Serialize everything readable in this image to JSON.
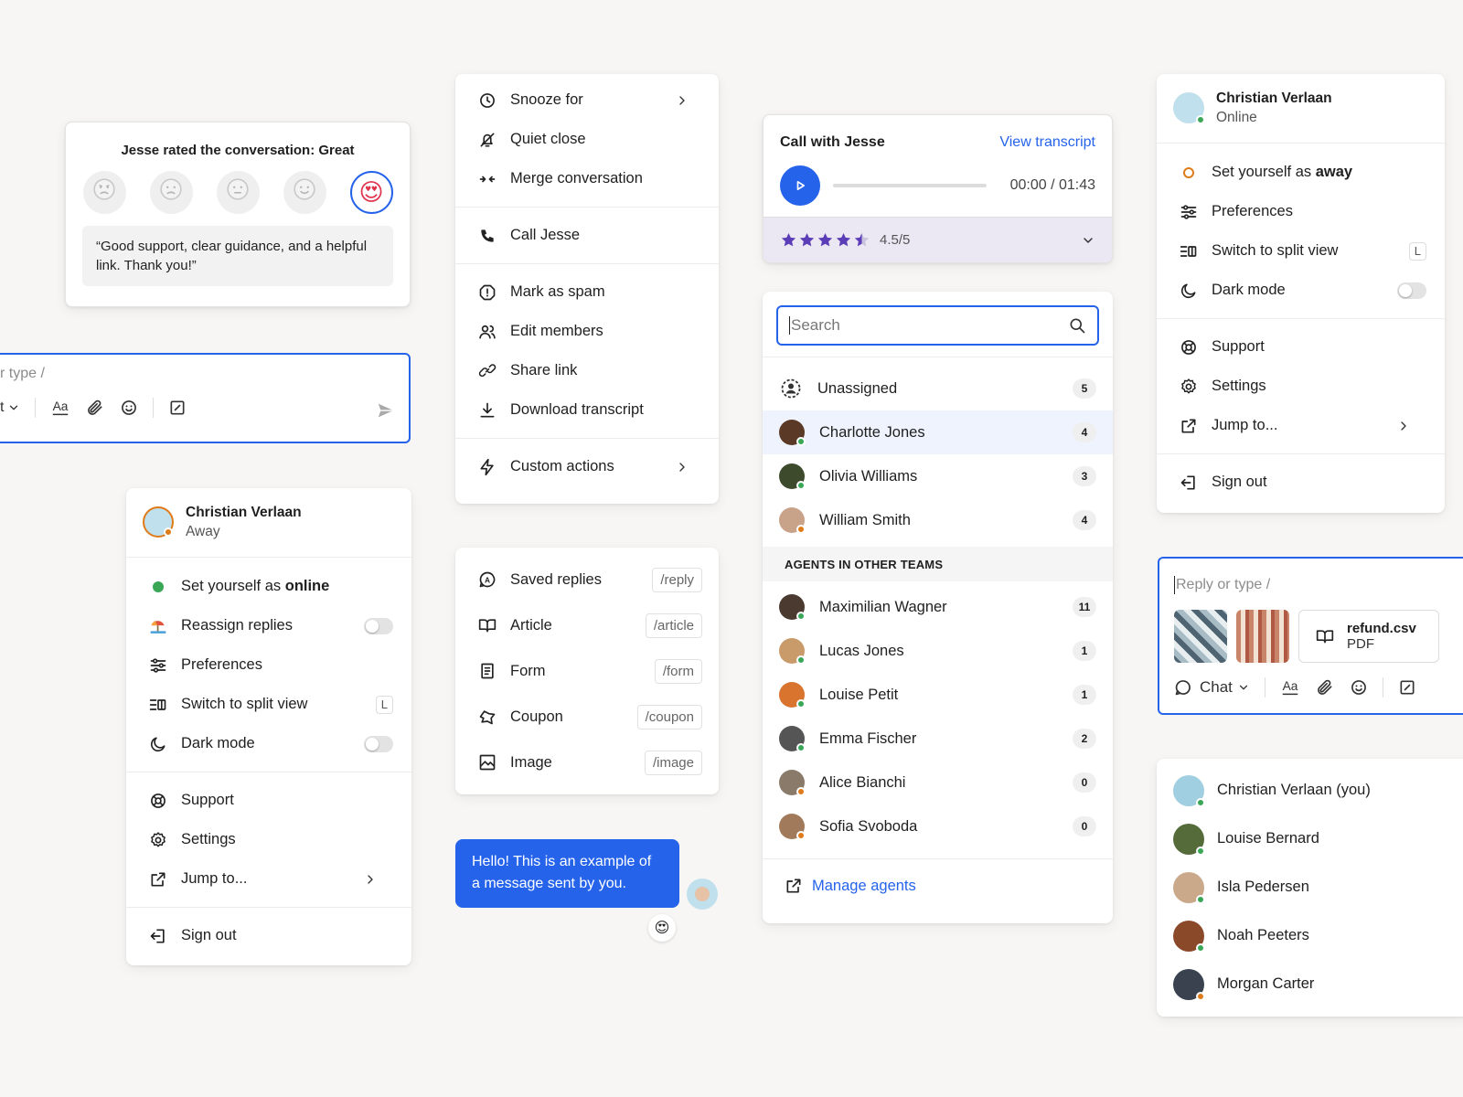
{
  "rating": {
    "title": "Jesse rated the conversation: Great",
    "faces": [
      "angry-face",
      "sad-face",
      "neutral-face",
      "smile-face",
      "heart-eyes-face"
    ],
    "selected": 4,
    "quote": "“Good support, clear guidance, and a helpful link. Thank you!”"
  },
  "composer_left": {
    "placeholder": "r type /",
    "mode_label": "t"
  },
  "menu": {
    "items": [
      {
        "label": "Snooze for",
        "icon": "clock-icon"
      },
      {
        "label": "Quiet close",
        "icon": "bell-off-icon"
      },
      {
        "label": "Merge conversation",
        "icon": "merge-icon"
      },
      {
        "label": "Call Jesse",
        "icon": "phone-icon"
      },
      {
        "label": "Mark as spam",
        "icon": "spam-icon"
      },
      {
        "label": "Edit members",
        "icon": "users-icon"
      },
      {
        "label": "Share link",
        "icon": "link-icon"
      },
      {
        "label": "Download transcript",
        "icon": "download-icon"
      },
      {
        "label": "Custom actions",
        "icon": "bolt-icon"
      }
    ]
  },
  "slash": {
    "items": [
      {
        "label": "Saved replies",
        "cmd": "/reply",
        "icon": "saved-reply-icon"
      },
      {
        "label": "Article",
        "cmd": "/article",
        "icon": "book-icon"
      },
      {
        "label": "Form",
        "cmd": "/form",
        "icon": "form-icon"
      },
      {
        "label": "Coupon",
        "cmd": "/coupon",
        "icon": "coupon-icon"
      },
      {
        "label": "Image",
        "cmd": "/image",
        "icon": "image-icon"
      }
    ]
  },
  "message": {
    "text": "Hello! This is an example of a message sent by you.",
    "reaction": "😍"
  },
  "call": {
    "title": "Call with Jesse",
    "view_transcript": "View transcript",
    "time": "00:00 / 01:43",
    "progress": 0,
    "stars": 4.5,
    "rating_text": "4.5/5"
  },
  "agents": {
    "search_placeholder": "Search",
    "unassigned": {
      "label": "Unassigned",
      "count": "5"
    },
    "team": [
      {
        "name": "Charlotte Jones",
        "count": "4",
        "status": "online",
        "color": "#5a3a26"
      },
      {
        "name": "Olivia Williams",
        "count": "3",
        "status": "online",
        "color": "#3d4a2c"
      },
      {
        "name": "William Smith",
        "count": "4",
        "status": "away",
        "color": "#c9a28a"
      }
    ],
    "section_title": "AGENTS IN OTHER TEAMS",
    "others": [
      {
        "name": "Maximilian Wagner",
        "count": "11",
        "status": "online",
        "color": "#4a3a30"
      },
      {
        "name": "Lucas Jones",
        "count": "1",
        "status": "online",
        "color": "#c99b6a"
      },
      {
        "name": "Louise Petit",
        "count": "1",
        "status": "online",
        "color": "#d9742e"
      },
      {
        "name": "Emma Fischer",
        "count": "2",
        "status": "online",
        "color": "#555555"
      },
      {
        "name": "Alice Bianchi",
        "count": "0",
        "status": "away",
        "color": "#8a7a6a"
      },
      {
        "name": "Sofia Svoboda",
        "count": "0",
        "status": "away",
        "color": "#a07a5a"
      }
    ],
    "manage": "Manage agents"
  },
  "profile_away": {
    "name": "Christian Verlaan",
    "status": "Away",
    "set_prefix": "Set yourself as ",
    "set_bold": "online",
    "items": [
      {
        "label": "Reassign replies",
        "icon": "beach-icon",
        "extra": "toggle"
      },
      {
        "label": "Preferences",
        "icon": "sliders-icon"
      },
      {
        "label": "Switch to split view",
        "icon": "split-view-icon",
        "extra": "L"
      },
      {
        "label": "Dark mode",
        "icon": "moon-icon",
        "extra": "toggle"
      }
    ],
    "items2": [
      {
        "label": "Support",
        "icon": "lifebuoy-icon"
      },
      {
        "label": "Settings",
        "icon": "gear-icon"
      },
      {
        "label": "Jump to...",
        "icon": "external-link-icon"
      }
    ],
    "sign_out": "Sign out"
  },
  "profile_online": {
    "name": "Christian Verlaan",
    "status": "Online",
    "set_prefix": "Set yourself as ",
    "set_bold": "away",
    "items": [
      {
        "label": "Preferences",
        "icon": "sliders-icon"
      },
      {
        "label": "Switch to split view",
        "icon": "split-view-icon",
        "extra": "L"
      },
      {
        "label": "Dark mode",
        "icon": "moon-icon",
        "extra": "toggle"
      }
    ],
    "items2": [
      {
        "label": "Support",
        "icon": "lifebuoy-icon"
      },
      {
        "label": "Settings",
        "icon": "gear-icon"
      },
      {
        "label": "Jump to...",
        "icon": "external-link-icon"
      }
    ],
    "sign_out": "Sign out"
  },
  "composer_right": {
    "placeholder": "Reply or type /",
    "file_name": "refund.csv",
    "file_type": "PDF",
    "mode_label": "Chat"
  },
  "users": [
    {
      "name": "Christian Verlaan (you)",
      "status": "online",
      "color": "#9fcfe0"
    },
    {
      "name": "Louise Bernard",
      "status": "online",
      "color": "#556b3a"
    },
    {
      "name": "Isla Pedersen",
      "status": "online",
      "color": "#c9a98a"
    },
    {
      "name": "Noah Peeters",
      "status": "online",
      "color": "#8a4a2a"
    },
    {
      "name": "Morgan Carter",
      "status": "away",
      "color": "#3a4250"
    }
  ],
  "colors": {
    "accent": "#2563eb",
    "online": "#3aa757",
    "away": "#e07b1a",
    "star": "#5b3db8"
  }
}
